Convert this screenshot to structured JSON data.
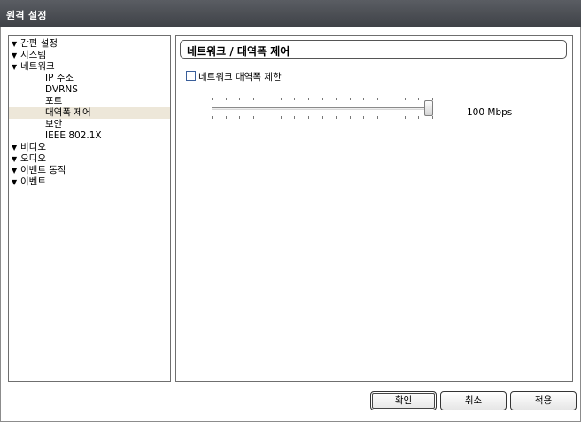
{
  "window": {
    "title": "원격 설정"
  },
  "tree": {
    "items": [
      {
        "label": "간편 설정",
        "expandable": true,
        "level": 0
      },
      {
        "label": "시스템",
        "expandable": true,
        "level": 0
      },
      {
        "label": "네트워크",
        "expandable": true,
        "level": 0
      },
      {
        "label": "IP 주소",
        "expandable": false,
        "level": 1
      },
      {
        "label": "DVRNS",
        "expandable": false,
        "level": 1
      },
      {
        "label": "포트",
        "expandable": false,
        "level": 1
      },
      {
        "label": "대역폭 제어",
        "expandable": false,
        "level": 1,
        "selected": true
      },
      {
        "label": "보안",
        "expandable": false,
        "level": 1
      },
      {
        "label": "IEEE 802.1X",
        "expandable": false,
        "level": 1
      },
      {
        "label": "비디오",
        "expandable": true,
        "level": 0
      },
      {
        "label": "오디오",
        "expandable": true,
        "level": 0
      },
      {
        "label": "이벤트 동작",
        "expandable": true,
        "level": 0
      },
      {
        "label": "이벤트",
        "expandable": true,
        "level": 0
      }
    ],
    "arrow_glyph": "▼"
  },
  "content": {
    "header": "네트워크 / 대역폭 제어",
    "limit_checkbox": {
      "label": "네트워크 대역폭 제한",
      "checked": false
    },
    "bandwidth_slider": {
      "value_label": "100 Mbps",
      "level": 1.0,
      "tick_count": 17
    }
  },
  "buttons": {
    "ok": "확인",
    "cancel": "취소",
    "apply": "적용"
  },
  "colors": {
    "titlebar": "#4a4d52",
    "selected_item": "#ede7d9",
    "checkbox_border": "#3a5e9a"
  }
}
